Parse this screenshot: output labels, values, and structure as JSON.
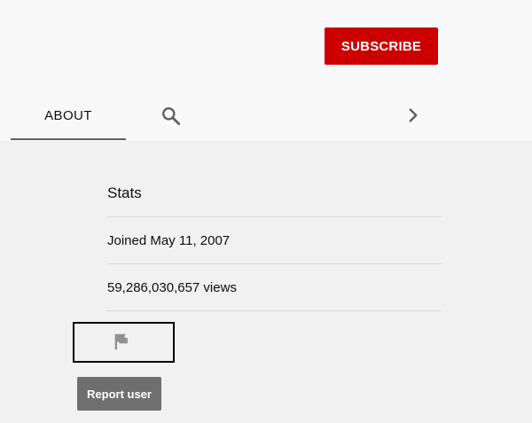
{
  "header": {
    "subscribe_label": "SUBSCRIBE"
  },
  "tabs": {
    "about_label": "ABOUT",
    "search_icon": "search-icon",
    "next_icon": "chevron-right-icon"
  },
  "stats": {
    "title": "Stats",
    "joined": "Joined May 11, 2007",
    "views": "59,286,030,657 views"
  },
  "actions": {
    "flag_icon": "flag-icon",
    "report_label": "Report user"
  },
  "colors": {
    "subscribe_bg": "#cc0000",
    "report_bg": "#6f6f6f",
    "header_bg": "#f9f9f9",
    "content_bg": "#f1f1f1"
  }
}
